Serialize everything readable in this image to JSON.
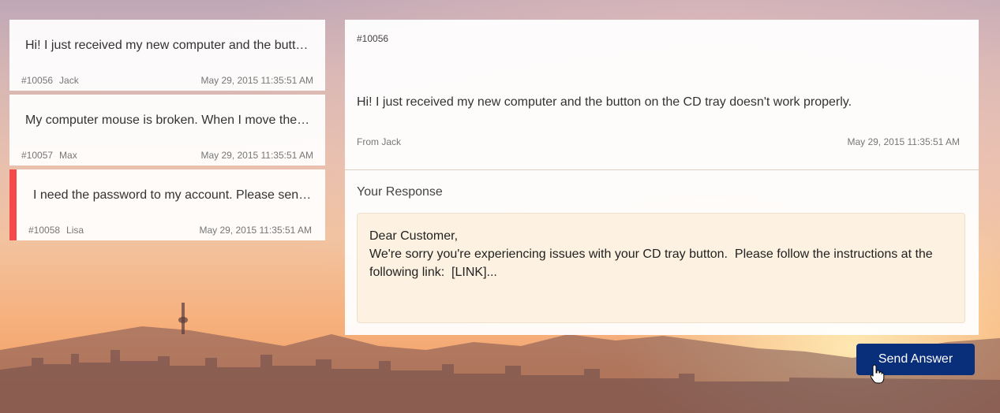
{
  "tickets": [
    {
      "message": "Hi! I just received my new computer and the button on the CD tray doesn't work properly.",
      "id": "#10056",
      "name": "Jack",
      "date": "May 29, 2015 11:35:51 AM",
      "selected": false
    },
    {
      "message": "My computer mouse is broken. When I move the mouse the cursor doesn't move.",
      "id": "#10057",
      "name": "Max",
      "date": "May 29, 2015 11:35:51 AM",
      "selected": false
    },
    {
      "message": "I need the password to my account. Please send it to me.",
      "id": "#10058",
      "name": "Lisa",
      "date": "May 29, 2015 11:35:51 AM",
      "selected": true
    }
  ],
  "detail": {
    "id": "#10056",
    "message": "Hi! I just received my new computer and the button on the CD tray doesn't work properly.",
    "from": "From Jack",
    "date": "May 29, 2015 11:35:51 AM",
    "response_label": "Your Response",
    "response_text": "Dear Customer,\nWe're sorry you're experiencing issues with your CD tray button.  Please follow the instructions at the following link:  [LINK]..."
  },
  "send_button": {
    "label": "Send Answer"
  },
  "colors": {
    "accent": "#f44a4a",
    "button": "#0a2f7a"
  },
  "icons": {
    "cursor": "hand-pointer-icon"
  }
}
